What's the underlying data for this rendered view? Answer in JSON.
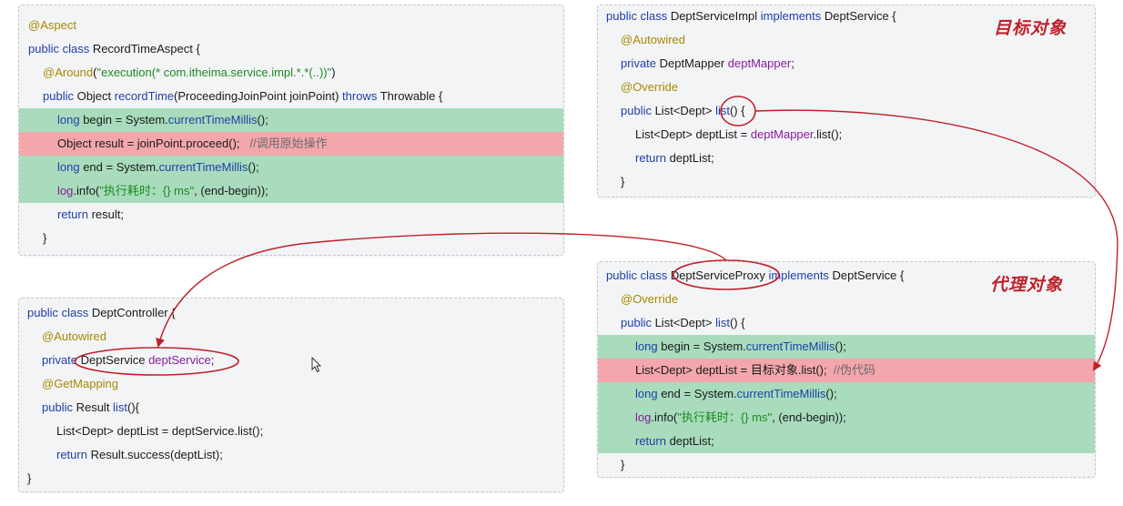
{
  "aspect": {
    "lines": [
      {
        "indent": 0,
        "hl": "",
        "tokens": [
          {
            "t": "@Aspect",
            "c": "ann"
          }
        ]
      },
      {
        "indent": 0,
        "hl": "",
        "tokens": [
          {
            "t": "public class ",
            "c": "kw"
          },
          {
            "t": "RecordTimeAspect {",
            "c": ""
          }
        ]
      },
      {
        "indent": 1,
        "hl": "",
        "tokens": [
          {
            "t": "@Around",
            "c": "ann"
          },
          {
            "t": "(",
            "c": ""
          },
          {
            "t": "\"execution(* com.itheima.service.impl.*.*(..))\"",
            "c": "str"
          },
          {
            "t": ")",
            "c": ""
          }
        ]
      },
      {
        "indent": 1,
        "hl": "",
        "tokens": [
          {
            "t": "public ",
            "c": "kw"
          },
          {
            "t": "Object ",
            "c": ""
          },
          {
            "t": "recordTime",
            "c": "kw"
          },
          {
            "t": "(ProceedingJoinPoint joinPoint) ",
            "c": ""
          },
          {
            "t": "throws ",
            "c": "kw"
          },
          {
            "t": "Throwable {",
            "c": ""
          }
        ]
      },
      {
        "indent": 2,
        "hl": "green",
        "tokens": [
          {
            "t": "long ",
            "c": "kw"
          },
          {
            "t": "begin = System.",
            "c": ""
          },
          {
            "t": "currentTimeMillis",
            "c": "kw"
          },
          {
            "t": "();",
            "c": ""
          }
        ]
      },
      {
        "indent": 2,
        "hl": "red",
        "tokens": [
          {
            "t": "Object result = joinPoint.proceed();   ",
            "c": ""
          },
          {
            "t": "//调用原始操作",
            "c": "cmt"
          }
        ]
      },
      {
        "indent": 2,
        "hl": "green",
        "tokens": [
          {
            "t": "long ",
            "c": "kw"
          },
          {
            "t": "end = System.",
            "c": ""
          },
          {
            "t": "currentTimeMillis",
            "c": "kw"
          },
          {
            "t": "();",
            "c": ""
          }
        ]
      },
      {
        "indent": 2,
        "hl": "green",
        "tokens": [
          {
            "t": "log",
            "c": "fld"
          },
          {
            "t": ".info(",
            "c": ""
          },
          {
            "t": "\"执行耗时：{} ms\"",
            "c": "str"
          },
          {
            "t": ", (end-begin));",
            "c": ""
          }
        ]
      },
      {
        "indent": 2,
        "hl": "",
        "tokens": [
          {
            "t": "return ",
            "c": "kw"
          },
          {
            "t": "result;",
            "c": ""
          }
        ]
      },
      {
        "indent": 1,
        "hl": "",
        "tokens": [
          {
            "t": "}",
            "c": ""
          }
        ]
      }
    ]
  },
  "controller": {
    "lines": [
      {
        "indent": 0,
        "hl": "",
        "tokens": [
          {
            "t": "public class ",
            "c": "kw"
          },
          {
            "t": "DeptController {",
            "c": ""
          }
        ]
      },
      {
        "indent": 1,
        "hl": "",
        "tokens": [
          {
            "t": "@Autowired",
            "c": "ann"
          }
        ]
      },
      {
        "indent": 1,
        "hl": "",
        "tokens": [
          {
            "t": "private ",
            "c": "kw"
          },
          {
            "t": "DeptService ",
            "c": ""
          },
          {
            "t": "deptService",
            "c": "fld"
          },
          {
            "t": ";",
            "c": ""
          }
        ]
      },
      {
        "indent": 1,
        "hl": "",
        "tokens": [
          {
            "t": "@GetMapping",
            "c": "ann"
          }
        ]
      },
      {
        "indent": 1,
        "hl": "",
        "tokens": [
          {
            "t": "public ",
            "c": "kw"
          },
          {
            "t": "Result ",
            "c": ""
          },
          {
            "t": "list",
            "c": "kw"
          },
          {
            "t": "(){",
            "c": ""
          }
        ]
      },
      {
        "indent": 2,
        "hl": "",
        "tokens": [
          {
            "t": "List<Dept> deptList = deptService.list();",
            "c": ""
          }
        ]
      },
      {
        "indent": 2,
        "hl": "",
        "tokens": [
          {
            "t": "return ",
            "c": "kw"
          },
          {
            "t": "Result.success(deptList);",
            "c": ""
          }
        ]
      },
      {
        "indent": 0,
        "hl": "",
        "tokens": [
          {
            "t": "}",
            "c": ""
          }
        ]
      }
    ]
  },
  "target": {
    "label": "目标对象",
    "lines": [
      {
        "indent": 0,
        "hl": "",
        "tokens": [
          {
            "t": "public class ",
            "c": "kw"
          },
          {
            "t": "DeptServiceImpl ",
            "c": ""
          },
          {
            "t": "implements ",
            "c": "kw"
          },
          {
            "t": "DeptService {",
            "c": ""
          }
        ]
      },
      {
        "indent": 1,
        "hl": "",
        "tokens": [
          {
            "t": "@Autowired",
            "c": "ann"
          }
        ]
      },
      {
        "indent": 1,
        "hl": "",
        "tokens": [
          {
            "t": "private ",
            "c": "kw"
          },
          {
            "t": "DeptMapper ",
            "c": ""
          },
          {
            "t": "deptMapper",
            "c": "fld"
          },
          {
            "t": ";",
            "c": ""
          }
        ]
      },
      {
        "indent": 1,
        "hl": "",
        "tokens": [
          {
            "t": "@Override",
            "c": "ann"
          }
        ]
      },
      {
        "indent": 1,
        "hl": "",
        "tokens": [
          {
            "t": "public ",
            "c": "kw"
          },
          {
            "t": "List<Dept> ",
            "c": ""
          },
          {
            "t": "list",
            "c": "kw"
          },
          {
            "t": "() {",
            "c": ""
          }
        ]
      },
      {
        "indent": 2,
        "hl": "",
        "tokens": [
          {
            "t": "List<Dept> deptList = ",
            "c": ""
          },
          {
            "t": "deptMapper",
            "c": "fld"
          },
          {
            "t": ".list();",
            "c": ""
          }
        ]
      },
      {
        "indent": 2,
        "hl": "",
        "tokens": [
          {
            "t": "return ",
            "c": "kw"
          },
          {
            "t": "deptList;",
            "c": ""
          }
        ]
      },
      {
        "indent": 1,
        "hl": "",
        "tokens": [
          {
            "t": "}",
            "c": ""
          }
        ]
      }
    ]
  },
  "proxy": {
    "label": "代理对象",
    "lines": [
      {
        "indent": 0,
        "hl": "",
        "tokens": [
          {
            "t": "public class ",
            "c": "kw"
          },
          {
            "t": "DeptServiceProxy ",
            "c": ""
          },
          {
            "t": "implements ",
            "c": "kw"
          },
          {
            "t": "DeptService {",
            "c": ""
          }
        ]
      },
      {
        "indent": 1,
        "hl": "",
        "tokens": [
          {
            "t": "@Override",
            "c": "ann"
          }
        ]
      },
      {
        "indent": 1,
        "hl": "",
        "tokens": [
          {
            "t": "public ",
            "c": "kw"
          },
          {
            "t": "List<Dept> ",
            "c": ""
          },
          {
            "t": "list",
            "c": "kw"
          },
          {
            "t": "() {",
            "c": ""
          }
        ]
      },
      {
        "indent": 2,
        "hl": "green",
        "tokens": [
          {
            "t": "long ",
            "c": "kw"
          },
          {
            "t": "begin = System.",
            "c": ""
          },
          {
            "t": "currentTimeMillis",
            "c": "kw"
          },
          {
            "t": "();",
            "c": ""
          }
        ]
      },
      {
        "indent": 2,
        "hl": "red",
        "tokens": [
          {
            "t": "List<Dept> deptList = 目标对象.list();  ",
            "c": ""
          },
          {
            "t": "//伪代码",
            "c": "cmt"
          }
        ]
      },
      {
        "indent": 2,
        "hl": "green",
        "tokens": [
          {
            "t": "long ",
            "c": "kw"
          },
          {
            "t": "end = System.",
            "c": ""
          },
          {
            "t": "currentTimeMillis",
            "c": "kw"
          },
          {
            "t": "();",
            "c": ""
          }
        ]
      },
      {
        "indent": 2,
        "hl": "green",
        "tokens": [
          {
            "t": "log",
            "c": "fld"
          },
          {
            "t": ".info(",
            "c": ""
          },
          {
            "t": "\"执行耗时：{} ms\"",
            "c": "str"
          },
          {
            "t": ", (end-begin));",
            "c": ""
          }
        ]
      },
      {
        "indent": 2,
        "hl": "green",
        "tokens": [
          {
            "t": "return ",
            "c": "kw"
          },
          {
            "t": "deptList;",
            "c": ""
          }
        ]
      },
      {
        "indent": 1,
        "hl": "",
        "tokens": [
          {
            "t": "}",
            "c": ""
          }
        ]
      }
    ]
  },
  "colors": {
    "arrow": "#c0202a",
    "highlight_green": "#a8dcbd",
    "highlight_red": "#f3a7ad"
  }
}
